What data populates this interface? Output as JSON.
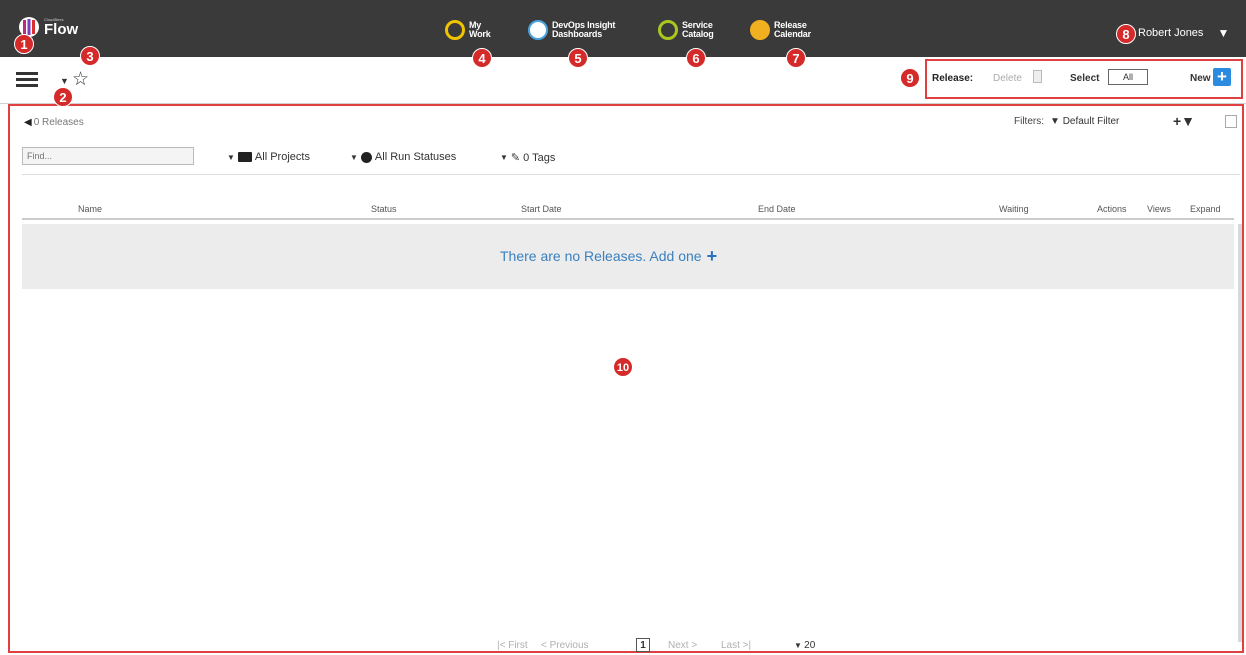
{
  "app": {
    "logo_subtext": "CloudBees",
    "logo_text": "Flow"
  },
  "nav": [
    {
      "line1": "My",
      "line2": "Work",
      "icon": "my-work-icon",
      "color": "#f0c400"
    },
    {
      "line1": "DevOps Insight",
      "line2": "Dashboards",
      "icon": "dashboards-icon",
      "color": "#4aa3df"
    },
    {
      "line1": "Service",
      "line2": "Catalog",
      "icon": "service-catalog-icon",
      "color": "#a8c820"
    },
    {
      "line1": "Release",
      "line2": "Calendar",
      "icon": "release-calendar-icon",
      "color": "#f0b020"
    }
  ],
  "user": {
    "name": "Robert Jones"
  },
  "badges": [
    "1",
    "2",
    "3",
    "4",
    "5",
    "6",
    "7",
    "8",
    "9",
    "10"
  ],
  "toolbar": {
    "release_label": "Release:",
    "delete_label": "Delete",
    "select_label": "Select",
    "select_value": "All",
    "new_label": "New"
  },
  "list": {
    "back_label": "0 Releases",
    "filters_label": "Filters:",
    "default_filter": "Default Filter",
    "find_placeholder": "Find...",
    "projects": "All Projects",
    "run_statuses": "All Run Statuses",
    "tags": "0 Tags",
    "columns": {
      "name": "Name",
      "status": "Status",
      "start": "Start Date",
      "end": "End Date",
      "waiting": "Waiting",
      "actions": "Actions",
      "views": "Views",
      "expand": "Expand"
    },
    "empty_message": "There are no Releases. Add one"
  },
  "pagination": {
    "first": "First",
    "previous": "Previous",
    "page": "1",
    "next": "Next",
    "last": "Last",
    "page_size": "20"
  }
}
